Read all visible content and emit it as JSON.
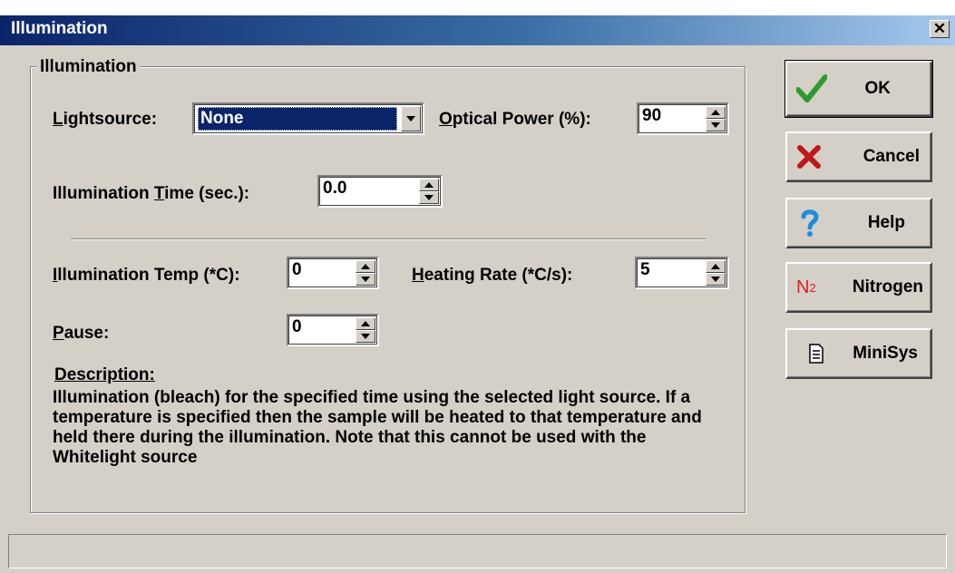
{
  "window": {
    "title": "Illumination",
    "close_glyph": "✕"
  },
  "group": {
    "legend": "Illumination"
  },
  "lightsource": {
    "label_accel": "L",
    "label_rest": "ightsource:",
    "selected": "None",
    "highlight_color": "#0a246a"
  },
  "optical_power": {
    "label_accel": "O",
    "label_rest": "ptical Power (%):",
    "value": "90"
  },
  "illumination_time": {
    "label_pre": "Illumination ",
    "label_accel": "T",
    "label_rest": "ime (sec.):",
    "value": "0.0"
  },
  "illumination_temp": {
    "label_accel": "I",
    "label_rest": "llumination Temp (*C):",
    "value": "0"
  },
  "heating_rate": {
    "label_accel": "H",
    "label_rest": "eating Rate (*C/s):",
    "value": "5"
  },
  "pause": {
    "label_accel": "P",
    "label_rest": "ause:",
    "value": "0"
  },
  "description": {
    "heading": "Description:",
    "text": "Illumination (bleach) for the specified time using the selected light source. If a temperature is specified then the sample will be heated to that temperature and held there during the illumination. Note that this cannot be used with the Whitelight source"
  },
  "buttons": {
    "ok": {
      "label": "OK",
      "icon": "checkmark-icon",
      "color": "#2e9a2e"
    },
    "cancel": {
      "label": "Cancel",
      "icon": "x-icon",
      "color": "#c01818"
    },
    "help": {
      "label": "Help",
      "icon": "question-icon",
      "color": "#1a8fd8"
    },
    "nitrogen": {
      "label": "Nitrogen",
      "icon_main": "N",
      "icon_sub": "2",
      "icon": "nitrogen-icon",
      "color": "#e02020"
    },
    "minisys": {
      "label": "MiniSys",
      "icon": "document-icon"
    }
  },
  "status": {
    "text": ""
  }
}
